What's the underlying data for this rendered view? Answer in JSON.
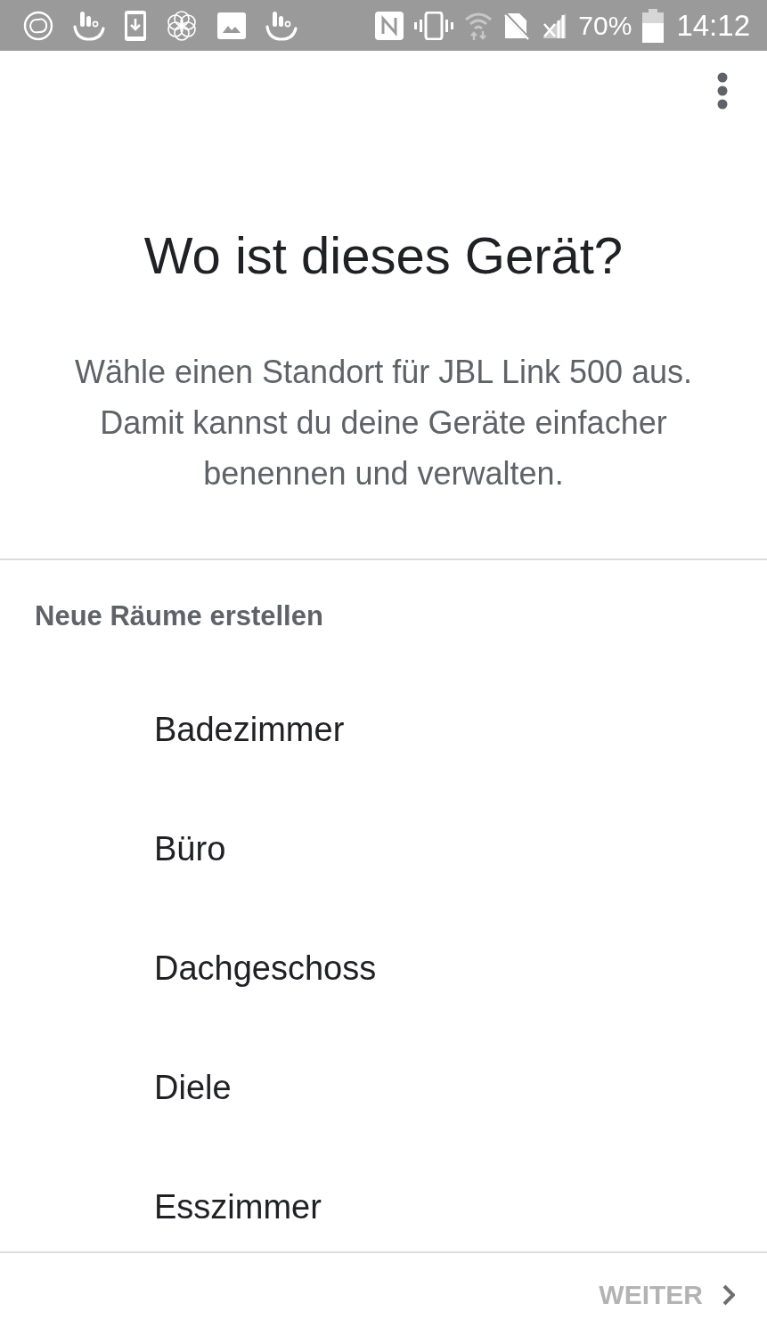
{
  "status_bar": {
    "battery_text": "70%",
    "time": "14:12"
  },
  "title": "Wo ist dieses Gerät?",
  "description": "Wähle einen Standort für JBL Link 500 aus. Damit kannst du deine Geräte einfacher benennen und verwalten.",
  "section": {
    "heading": "Neue Räume erstellen",
    "rooms": [
      {
        "label": "Badezimmer"
      },
      {
        "label": "Büro"
      },
      {
        "label": "Dachgeschoss"
      },
      {
        "label": "Diele"
      },
      {
        "label": "Esszimmer"
      }
    ]
  },
  "footer": {
    "next_button": {
      "label": "WEITER",
      "disabled": true
    }
  }
}
